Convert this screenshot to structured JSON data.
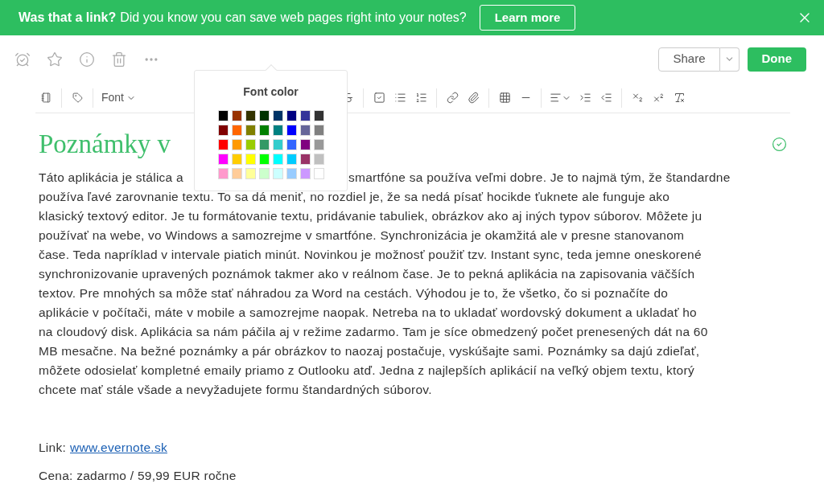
{
  "banner": {
    "lead": "Was that a link?",
    "text": "Did you know you can save web pages right into your notes?",
    "button": "Learn more"
  },
  "actions": {
    "share": "Share",
    "done": "Done"
  },
  "toolbar": {
    "font": "Font"
  },
  "font_color": {
    "title": "Font color",
    "swatches": [
      {
        "color": "#000000"
      },
      {
        "color": "#993300"
      },
      {
        "color": "#333300"
      },
      {
        "color": "#003300"
      },
      {
        "color": "#003366"
      },
      {
        "color": "#000080"
      },
      {
        "color": "#333399"
      },
      {
        "color": "#333333"
      },
      {
        "color": "#800000"
      },
      {
        "color": "#ff6600"
      },
      {
        "color": "#808000"
      },
      {
        "color": "#008000"
      },
      {
        "color": "#008080"
      },
      {
        "color": "#0000ff"
      },
      {
        "color": "#666699"
      },
      {
        "color": "#808080"
      },
      {
        "color": "#ff0000"
      },
      {
        "color": "#ff9900"
      },
      {
        "color": "#99cc00"
      },
      {
        "color": "#339966"
      },
      {
        "color": "#33cccc"
      },
      {
        "color": "#3366ff"
      },
      {
        "color": "#800080"
      },
      {
        "color": "#999999"
      },
      {
        "color": "#ff00ff"
      },
      {
        "color": "#ffcc00"
      },
      {
        "color": "#ffff00"
      },
      {
        "color": "#00ff00"
      },
      {
        "color": "#00ffff"
      },
      {
        "color": "#00ccff"
      },
      {
        "color": "#993366"
      },
      {
        "color": "#c0c0c0"
      },
      {
        "color": "#ff99cc"
      },
      {
        "color": "#ffcc99"
      },
      {
        "color": "#ffff99"
      },
      {
        "color": "#ccffcc"
      },
      {
        "color": "#ccffff"
      },
      {
        "color": "#99ccff"
      },
      {
        "color": "#cc99ff"
      },
      {
        "color": "#ffffff"
      }
    ]
  },
  "note": {
    "title": "Poznámky v",
    "first_line": [
      "Táto aplikácia je stálica a",
      "smartfóne sa používa veľmi dobre. Je to najmä tým, že štandardne"
    ],
    "lines": [
      "používa ľavé zarovnanie textu. To sa dá meniť, no rozdiel je, že sa nedá písať hocikde ťuknete ale funguje ako",
      "klasický textový editor. Je tu formátovanie textu, pridávanie tabuliek, obrázkov ako aj iných typov súborov. Môžete ju",
      "používať na webe, vo Windows a samozrejme v smartfóne. Synchronizácia je okamžitá ale v presne stanovanom",
      "čase. Teda napríklad v intervale piatich minút. Novinkou je možnosť použiť tzv. Instant sync, teda jemne oneskorené",
      "synchronizovanie upravených poznámok takmer ako v reálnom čase. Je to pekná aplikácia na zapisovania väčších",
      "textov. Pre mnohých sa môže stať náhradou za Word na cestách. Výhodou je to, že všetko, čo si poznačíte do",
      "aplikácie v počítači, máte v mobile a samozrejme naopak. Netreba na to ukladať wordovský dokument a ukladať ho",
      "na cloudový disk. Aplikácia sa nám páčila aj v režime zadarmo. Tam je síce obmedzený počet prenesených dát na 60",
      "MB mesačne. Na bežné poznámky a pár obrázkov to naozaj postačuje, vyskúšajte sami. Poznámky sa dajú zdieľať,",
      "môžete odosielať kompletné emaily priamo z Outlooku atď. Jedna z najlepších aplikácií na veľký objem textu, ktorý",
      "chcete mať stále všade a nevyžadujete formu štandardných súborov."
    ],
    "link_label": "Link:",
    "link": "www.evernote.sk",
    "price": "Cena: zadarmo / 59,99 EUR ročne"
  }
}
